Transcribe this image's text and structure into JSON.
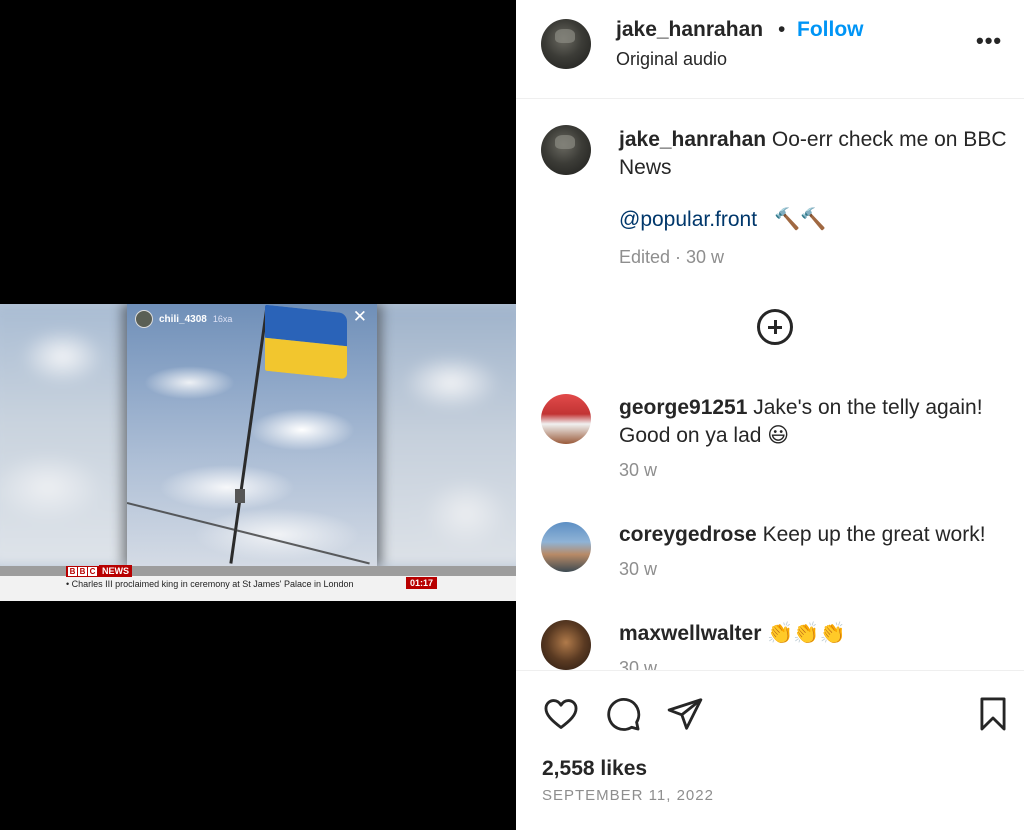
{
  "video": {
    "story_user": "chili_4308",
    "story_time": "16xa",
    "story_dots": "···",
    "story_close": "✕",
    "bbc_letters": [
      "B",
      "B",
      "C"
    ],
    "bbc_news": "NEWS",
    "headline": "• Charles III proclaimed king in ceremony at St James' Palace in London",
    "clock": "01:17"
  },
  "header": {
    "username": "jake_hanrahan",
    "separator": "•",
    "follow_label": "Follow",
    "audio": "Original audio",
    "more": "•••"
  },
  "caption": {
    "username": "jake_hanrahan",
    "text": " Oo-err check me on BBC News",
    "mention": "@popular.front",
    "emoji": "🔨🔨",
    "edited": "Edited · 30 w"
  },
  "comments": [
    {
      "username": "george91251",
      "text": " Jake's on the telly again! Good on ya lad 😃",
      "time": "30 w"
    },
    {
      "username": "coreygedrose",
      "text": " Keep up the great work!",
      "time": "30 w"
    },
    {
      "username": "maxwellwalter",
      "text": " 👏👏👏",
      "time": "30 w"
    }
  ],
  "footer": {
    "likes": "2,558 likes",
    "date": "SEPTEMBER 11, 2022"
  },
  "colors": {
    "follow": "#0095f6",
    "mention": "#00376b",
    "muted": "#8e8e8e",
    "bbc_red": "#b80000"
  },
  "icons": {
    "like": "heart-icon",
    "comment": "comment-icon",
    "share": "paper-plane-icon",
    "save": "bookmark-icon",
    "more": "more-options-icon",
    "add": "plus-circle-icon"
  }
}
